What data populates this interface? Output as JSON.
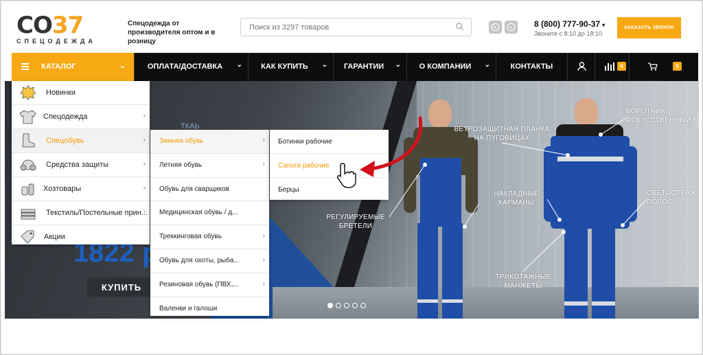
{
  "brand": {
    "logo_main": "CO",
    "logo_accent": "37",
    "logo_sub": "СПЕЦОДЕЖДА",
    "tagline": "Спецодежда от производителя оптом и в розницу"
  },
  "search": {
    "placeholder": "Поиск из 3297 товаров",
    "icon": "search-icon"
  },
  "contacts": {
    "phone": "8 (800) 777-90-37",
    "hours": "Звоните с 8:10 до 18:10",
    "callback_label": "ЗАКАЗАТЬ ЗВОНОК",
    "messengers": [
      "viber-icon",
      "whatsapp-icon"
    ]
  },
  "nav": {
    "catalog_label": "КАТАЛОГ",
    "items": [
      {
        "label": "ОПЛАТА/ДОСТАВКА",
        "has_dropdown": true
      },
      {
        "label": "КАК КУПИТЬ",
        "has_dropdown": true
      },
      {
        "label": "ГАРАНТИИ",
        "has_dropdown": true
      },
      {
        "label": "О КОМПАНИИ",
        "has_dropdown": true
      },
      {
        "label": "КОНТАКТЫ",
        "has_dropdown": false
      }
    ],
    "compare_count": "0",
    "cart_count": "0"
  },
  "catalog_menu": [
    {
      "label": "Новинки",
      "icon": "new-badge-icon",
      "arrow": false
    },
    {
      "label": "Спецодежда",
      "icon": "jacket-icon",
      "arrow": true
    },
    {
      "label": "Спецобувь",
      "icon": "boot-icon",
      "arrow": true,
      "active": true
    },
    {
      "label": "Средства защиты",
      "icon": "respirator-icon",
      "arrow": true
    },
    {
      "label": "Хозтовары",
      "icon": "cleaning-icon",
      "arrow": true
    },
    {
      "label": "Текстиль/Постельные прин...",
      "icon": "textile-icon",
      "arrow": true
    },
    {
      "label": "Акции",
      "icon": "tag-icon",
      "arrow": false
    }
  ],
  "shoes_menu": [
    {
      "label": "Зимняя обувь",
      "arrow": true,
      "active": true
    },
    {
      "label": "Летняя обувь",
      "arrow": true
    },
    {
      "label": "Обувь для сварщиков",
      "arrow": false
    },
    {
      "label": "Медицинская обувь / д...",
      "arrow": false
    },
    {
      "label": "Треккинговая обувь",
      "arrow": true
    },
    {
      "label": "Обувь для охоты, рыба...",
      "arrow": true
    },
    {
      "label": "Резиновая обувь (ПВХ,...",
      "arrow": true
    },
    {
      "label": "Валенки и галоши",
      "arrow": false
    }
  ],
  "winter_menu": [
    {
      "label": "Ботинки рабочие"
    },
    {
      "label": "Сапоги рабочие",
      "active": true
    },
    {
      "label": "Берцы"
    }
  ],
  "hero": {
    "price": "1822 р",
    "buy_label": "КУПИТЬ",
    "faint_text": "ТКАЬ",
    "labels": {
      "flap": "ВЕТРОЗАЩИТНАЯ ПЛАНКА\nНА ПУГОВИЦАХ",
      "collar": "ВОРОТНИК\nИСКУССТВЕННЫЙ М",
      "pockets": "НАКЛАДНЫЕ\nКАРМАНЫ",
      "reflective": "СВЕТООТРАЖ\nПОЛОС",
      "straps": "РЕГУЛИРУЕМЫЕ\nБРЕТЕЛИ",
      "cuffs": "ТРИКОТАЖНЫЕ\nМАНЖЕТЫ"
    },
    "slides": 5,
    "active_slide": 0
  },
  "colors": {
    "accent": "#f6a912",
    "nav_bg": "#0d0d0d",
    "active_text": "#f29a05",
    "arrow_red": "#d0131b",
    "suit_blue": "#1f4da8"
  }
}
